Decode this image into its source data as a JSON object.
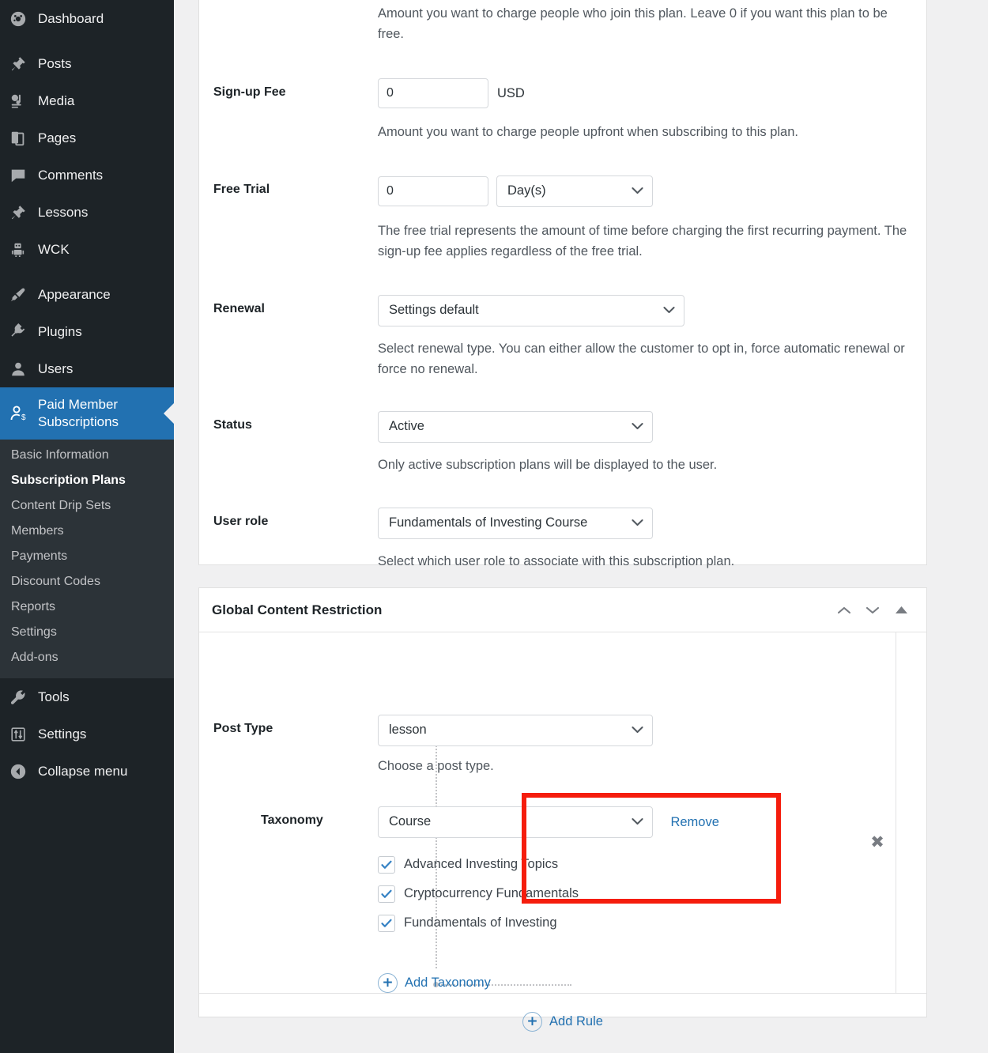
{
  "sidebar": {
    "items": [
      {
        "label": "Dashboard",
        "icon": "dashboard-icon",
        "gap_before": false,
        "current": false
      },
      {
        "label": "Posts",
        "icon": "pin-icon",
        "gap_before": true,
        "current": false
      },
      {
        "label": "Media",
        "icon": "media-icon",
        "gap_before": false,
        "current": false
      },
      {
        "label": "Pages",
        "icon": "pages-icon",
        "gap_before": false,
        "current": false
      },
      {
        "label": "Comments",
        "icon": "comments-icon",
        "gap_before": false,
        "current": false
      },
      {
        "label": "Lessons",
        "icon": "pin-icon",
        "gap_before": false,
        "current": false
      },
      {
        "label": "WCK",
        "icon": "robot-icon",
        "gap_before": false,
        "current": false
      },
      {
        "label": "Appearance",
        "icon": "brush-icon",
        "gap_before": true,
        "current": false
      },
      {
        "label": "Plugins",
        "icon": "plugin-icon",
        "gap_before": false,
        "current": false
      },
      {
        "label": "Users",
        "icon": "user-icon",
        "gap_before": false,
        "current": false
      },
      {
        "label": "Paid Member Subscriptions",
        "icon": "member-dollar-icon",
        "gap_before": false,
        "current": true
      }
    ],
    "submenu": [
      {
        "label": "Basic Information",
        "current": false
      },
      {
        "label": "Subscription Plans",
        "current": true
      },
      {
        "label": "Content Drip Sets",
        "current": false
      },
      {
        "label": "Members",
        "current": false
      },
      {
        "label": "Payments",
        "current": false
      },
      {
        "label": "Discount Codes",
        "current": false
      },
      {
        "label": "Reports",
        "current": false
      },
      {
        "label": "Settings",
        "current": false
      },
      {
        "label": "Add-ons",
        "current": false
      }
    ],
    "items_after": [
      {
        "label": "Tools",
        "icon": "wrench-icon"
      },
      {
        "label": "Settings",
        "icon": "settings-sliders-icon"
      },
      {
        "label": "Collapse menu",
        "icon": "collapse-arrow-icon"
      }
    ]
  },
  "plan_details": {
    "price_desc": "Amount you want to charge people who join this plan. Leave 0 if you want this plan to be free.",
    "signup_fee": {
      "label": "Sign-up Fee",
      "value": "0",
      "currency": "USD",
      "desc": "Amount you want to charge people upfront when subscribing to this plan."
    },
    "free_trial": {
      "label": "Free Trial",
      "value": "0",
      "unit": "Day(s)",
      "desc": "The free trial represents the amount of time before charging the first recurring payment. The sign-up fee applies regardless of the free trial."
    },
    "renewal": {
      "label": "Renewal",
      "value": "Settings default",
      "desc": "Select renewal type. You can either allow the customer to opt in, force automatic renewal or force no renewal."
    },
    "status": {
      "label": "Status",
      "value": "Active",
      "desc": "Only active subscription plans will be displayed to the user."
    },
    "user_role": {
      "label": "User role",
      "value": "Fundamentals of Investing Course",
      "desc": "Select which user role to associate with this subscription plan."
    }
  },
  "global_restriction": {
    "panel_title": "Global Content Restriction",
    "post_type": {
      "label": "Post Type",
      "value": "lesson",
      "desc": "Choose a post type."
    },
    "taxonomy": {
      "label": "Taxonomy",
      "value": "Course",
      "remove_label": "Remove",
      "terms": [
        {
          "label": "Advanced Investing Topics",
          "checked": true
        },
        {
          "label": "Cryptocurrency Fundamentals",
          "checked": true
        },
        {
          "label": "Fundamentals of Investing",
          "checked": true
        }
      ]
    },
    "add_taxonomy_label": "Add Taxonomy",
    "add_rule_label": "Add Rule",
    "close_rule_glyph": "✖",
    "plus_glyph": "+"
  },
  "colors": {
    "accent_blue": "#2271b1",
    "sidebar_bg": "#1d2327",
    "submenu_bg": "#2c3338",
    "page_bg": "#f0f0f1",
    "highlight_red": "#f51d0d"
  }
}
